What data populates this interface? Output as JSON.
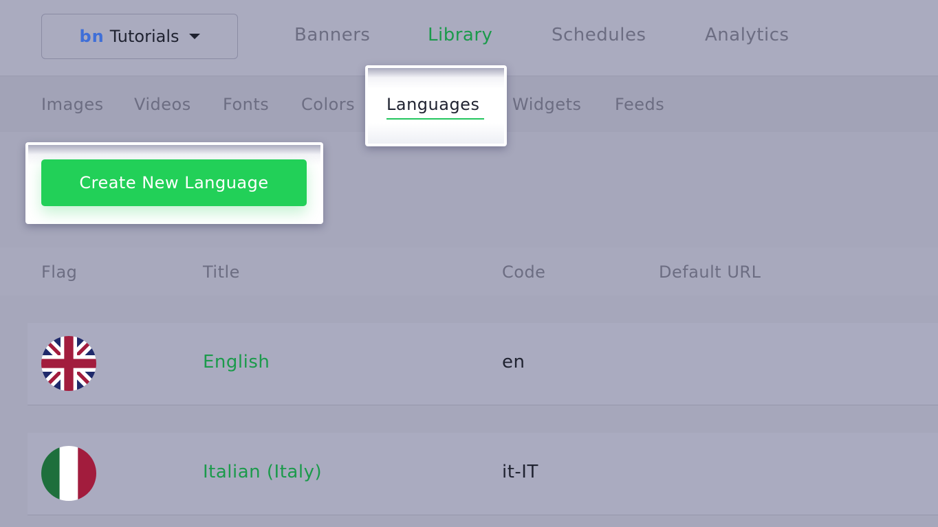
{
  "workspace": {
    "logo": "bn",
    "name": "Tutorials"
  },
  "main_nav": [
    {
      "label": "Banners"
    },
    {
      "label": "Library"
    },
    {
      "label": "Schedules"
    },
    {
      "label": "Analytics"
    }
  ],
  "active_main_nav": "Library",
  "sub_nav": [
    {
      "label": "Images"
    },
    {
      "label": "Videos"
    },
    {
      "label": "Fonts"
    },
    {
      "label": "Colors"
    },
    {
      "label": "Languages"
    },
    {
      "label": "Widgets"
    },
    {
      "label": "Feeds"
    }
  ],
  "active_sub_nav": "Languages",
  "create_button": {
    "label": "Create New Language"
  },
  "table": {
    "columns": [
      "Flag",
      "Title",
      "Code",
      "Default URL"
    ],
    "rows": [
      {
        "flag": "uk-flag-icon",
        "title": "English",
        "code": "en",
        "default_url": ""
      },
      {
        "flag": "italy-flag-icon",
        "title": "Italian (Italy)",
        "code": "it-IT",
        "default_url": ""
      }
    ]
  },
  "colors": {
    "active_nav": "#1b9a4b",
    "primary_button": "#22d058",
    "overlay_bg": "#a6a7bb",
    "logo_blue": "#3f6fd8"
  }
}
